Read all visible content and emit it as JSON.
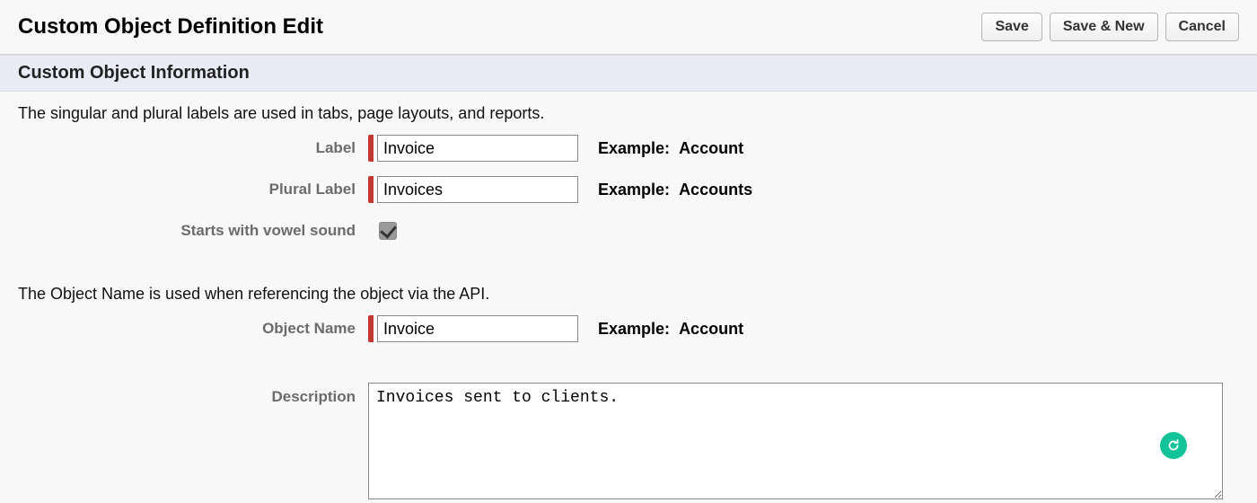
{
  "header": {
    "title": "Custom Object Definition Edit",
    "buttons": {
      "save": "Save",
      "save_new": "Save & New",
      "cancel": "Cancel"
    }
  },
  "section": {
    "title": "Custom Object Information"
  },
  "intro1": "The singular and plural labels are used in tabs, page layouts, and reports.",
  "intro2": "The Object Name is used when referencing the object via the API.",
  "fields": {
    "label": {
      "label": "Label",
      "value": "Invoice",
      "example_prefix": "Example:",
      "example_value": "Account"
    },
    "plural_label": {
      "label": "Plural Label",
      "value": "Invoices",
      "example_prefix": "Example:",
      "example_value": "Accounts"
    },
    "vowel": {
      "label": "Starts with vowel sound",
      "checked": true
    },
    "object_name": {
      "label": "Object Name",
      "value": "Invoice",
      "example_prefix": "Example:",
      "example_value": "Account"
    },
    "description": {
      "label": "Description",
      "value": "Invoices sent to clients."
    }
  },
  "icons": {
    "grammarly": "grammarly-icon"
  }
}
